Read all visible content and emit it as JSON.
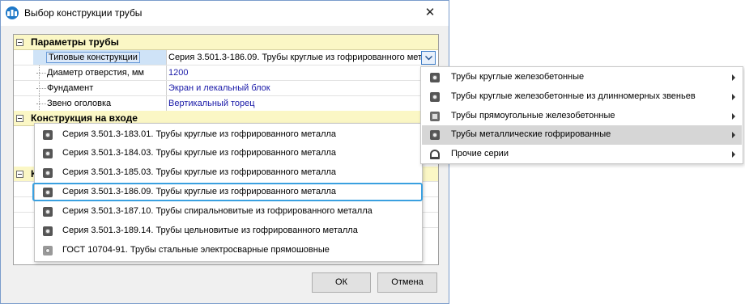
{
  "window": {
    "title": "Выбор конструкции трубы",
    "close_glyph": "✕"
  },
  "grid": {
    "cat_params": "Параметры трубы",
    "props": [
      {
        "name": "Типовые конструкции",
        "value": "Серия 3.501.3-186.09. Трубы круглые из гофрированного металла"
      },
      {
        "name": "Диаметр отверстия, мм",
        "value": "1200"
      },
      {
        "name": "Фундамент",
        "value": "Экран и лекальный блок"
      },
      {
        "name": "Звено оголовка",
        "value": "Вертикальный торец"
      }
    ],
    "cat_inlet": "Конструкция на входе",
    "cat_hidden_letter": "К"
  },
  "list": {
    "items": [
      {
        "label": "Серия 3.501.3-183.01. Трубы круглые из гофрированного металла"
      },
      {
        "label": "Серия 3.501.3-184.03. Трубы круглые из гофрированного металла"
      },
      {
        "label": "Серия 3.501.3-185.03. Трубы круглые из гофрированного металла"
      },
      {
        "label": "Серия 3.501.3-186.09. Трубы круглые из гофрированного металла"
      },
      {
        "label": "Серия 3.501.3-187.10. Трубы спиральновитые из гофрированного металла"
      },
      {
        "label": "Серия 3.501.3-189.14. Трубы цельновитые из гофрированного металла"
      },
      {
        "label": "ГОСТ 10704-91. Трубы стальные электросварные прямошовные"
      }
    ],
    "selected_index": 3
  },
  "menu": {
    "items": [
      {
        "label": "Трубы круглые железобетонные",
        "icon": "round-pipe-icon"
      },
      {
        "label": "Трубы круглые железобетонные из длинномерных звеньев",
        "icon": "round-pipe-icon"
      },
      {
        "label": "Трубы прямоугольные железобетонные",
        "icon": "box-pipe-icon"
      },
      {
        "label": "Трубы металлические гофрированные",
        "icon": "corrugated-pipe-icon"
      },
      {
        "label": "Прочие серии",
        "icon": "arch-pipe-icon"
      }
    ],
    "highlighted_index": 3
  },
  "buttons": {
    "ok": "ОК",
    "cancel": "Отмена"
  },
  "colors": {
    "category_bg": "#fbf7c5",
    "value_text": "#1a1aa8",
    "selection_border": "#3aa0e0",
    "menu_highlight": "#d6d6d6",
    "app_icon": "#1e78c8"
  }
}
